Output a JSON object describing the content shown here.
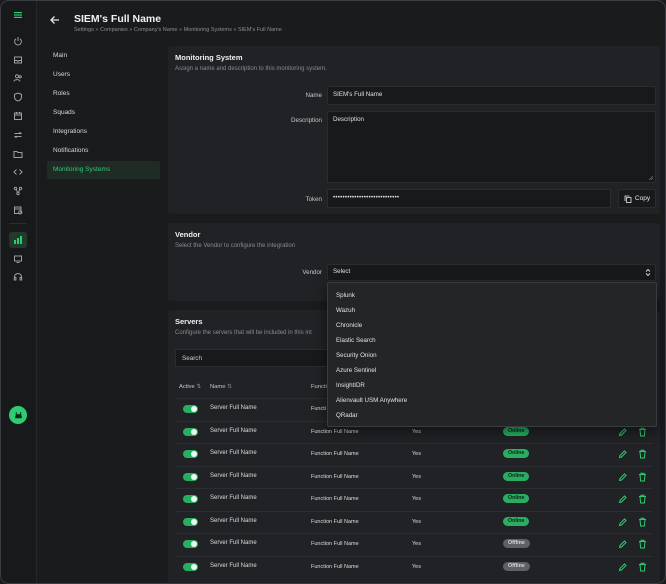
{
  "header": {
    "title": "SIEM's Full Name",
    "breadcrumb": "Settings » Companies » Company's Name » Monitoring Systems » SIEM's Full Name"
  },
  "nav": {
    "items": [
      "Main",
      "Users",
      "Roles",
      "Squads",
      "Integrations",
      "Notifications",
      "Monitoring Systems"
    ],
    "active": "Monitoring Systems"
  },
  "monitoring": {
    "title": "Monitoring System",
    "subtitle": "Assign a name and description to this monitoring system.",
    "name_label": "Name",
    "name_value": "SIEM's Full Name",
    "description_label": "Description",
    "description_value": "Description",
    "token_label": "Token",
    "token_value": "••••••••••••••••••••••••••••",
    "copy_label": "Copy"
  },
  "vendor": {
    "title": "Vendor",
    "subtitle": "Select the Vendor to configure the integration",
    "label": "Vendor",
    "selected": "Select",
    "options": [
      "Splunk",
      "Wazuh",
      "Chronicle",
      "Elastic Search",
      "Security Onion",
      "Azure Sentinel",
      "InsightIDR",
      "Alienvault USM Anywhere",
      "QRadar"
    ]
  },
  "servers": {
    "title": "Servers",
    "subtitle": "Configure the servers that will be included in this int",
    "search_placeholder": "Search",
    "columns": [
      "Active",
      "Name",
      "Functi"
    ],
    "rows": [
      {
        "name": "Server Full Name",
        "function": "Functi",
        "yes": "",
        "status": ""
      },
      {
        "name": "Server Full Name",
        "function": "Function Full Name",
        "yes": "Yes",
        "status": "Online"
      },
      {
        "name": "Server Full Name",
        "function": "Function Full Name",
        "yes": "Yes",
        "status": "Online"
      },
      {
        "name": "Server Full Name",
        "function": "Function Full Name",
        "yes": "Yes",
        "status": "Online"
      },
      {
        "name": "Server Full Name",
        "function": "Function Full Name",
        "yes": "Yes",
        "status": "Online"
      },
      {
        "name": "Server Full Name",
        "function": "Function Full Name",
        "yes": "Yes",
        "status": "Online"
      },
      {
        "name": "Server Full Name",
        "function": "Function Full Name",
        "yes": "Yes",
        "status": "Offline"
      },
      {
        "name": "Server Full Name",
        "function": "Function Full Name",
        "yes": "Yes",
        "status": "Offline"
      }
    ]
  },
  "colors": {
    "accent": "#2ecc71",
    "online": "#27ae60",
    "offline": "#5c6166",
    "background": "#191b1d",
    "panel": "#202225"
  }
}
